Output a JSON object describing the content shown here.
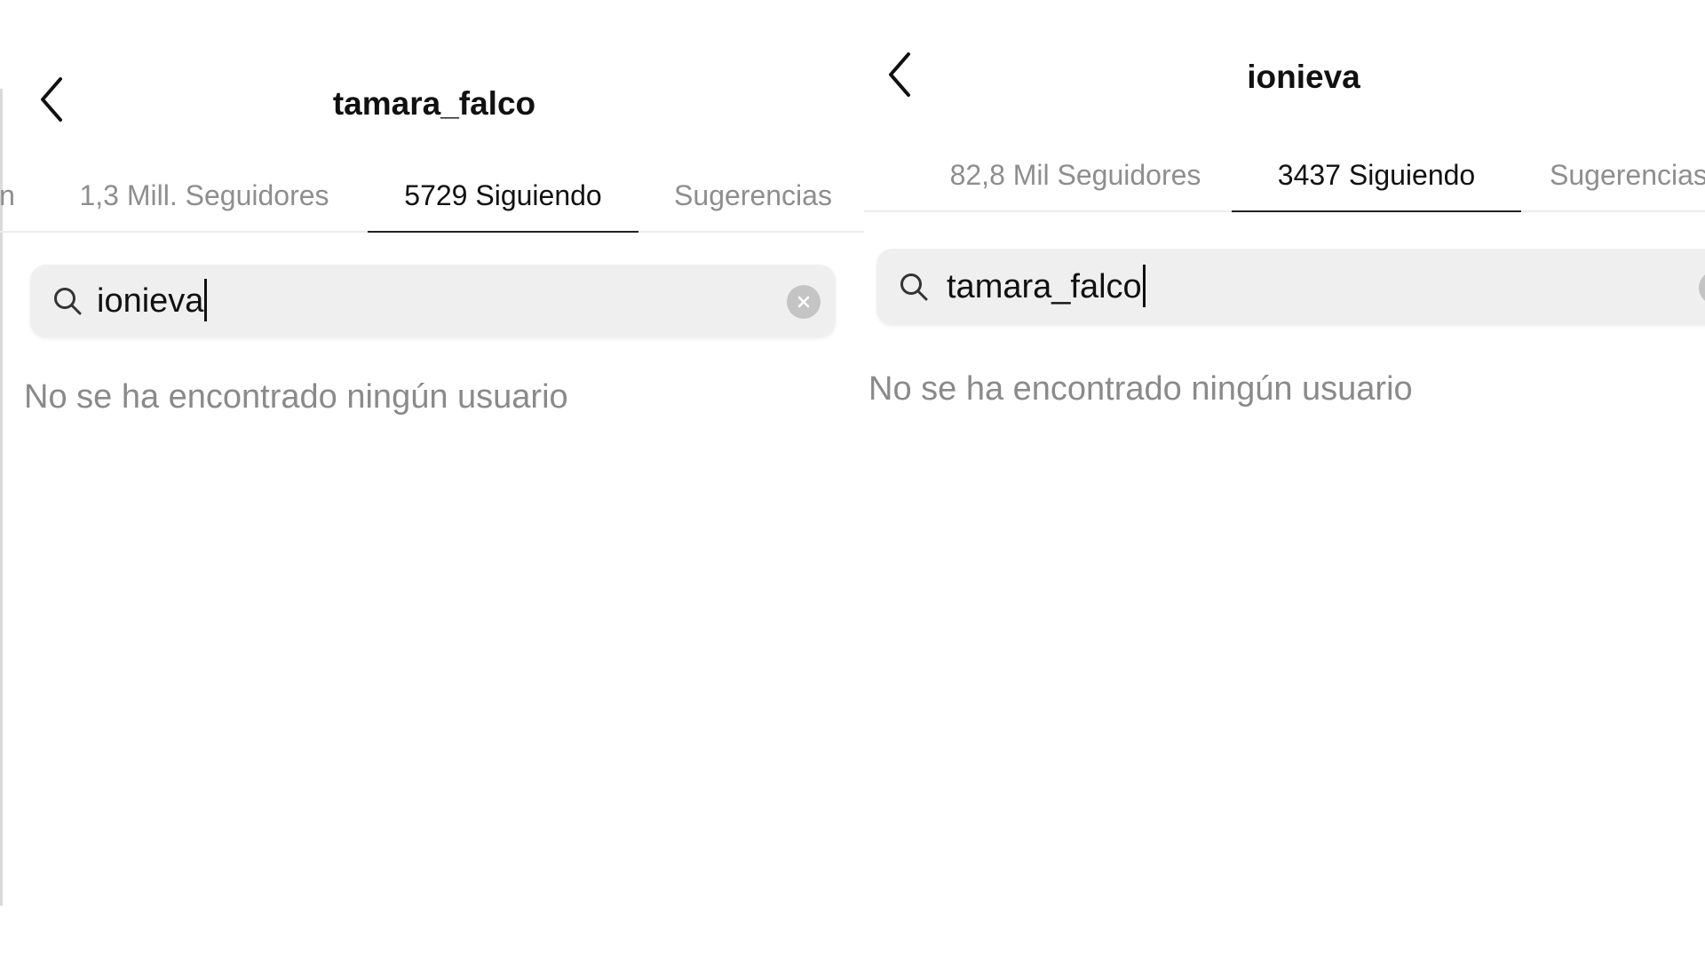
{
  "left": {
    "header": {
      "title": "tamara_falco",
      "back_icon": "chevron-left-icon"
    },
    "tabs": [
      {
        "label": "n"
      },
      {
        "label": "1,3 Mill. Seguidores"
      },
      {
        "label": "5729 Siguiendo"
      },
      {
        "label": "Sugerencias"
      }
    ],
    "active_tab": "5729 Siguiendo",
    "search": {
      "value": "ionieva",
      "icon": "search-icon",
      "clear_icon": "clear-icon"
    },
    "empty_message": "No se ha encontrado ningún usuario"
  },
  "right": {
    "header": {
      "title": "ionieva",
      "back_icon": "chevron-left-icon"
    },
    "tabs": [
      {
        "label": "82,8 Mil Seguidores"
      },
      {
        "label": "3437 Siguiendo"
      },
      {
        "label": "Sugerencias"
      }
    ],
    "active_tab": "3437 Siguiendo",
    "search": {
      "value": "tamara_falco",
      "icon": "search-icon",
      "clear_icon": "clear-icon"
    },
    "empty_message": "No se ha encontrado ningún usuario"
  },
  "colors": {
    "background": "#ffffff",
    "active_text": "#111111",
    "inactive_text": "#8e8e8e",
    "search_bg": "#efefef",
    "message_text": "#8a8a8a"
  }
}
